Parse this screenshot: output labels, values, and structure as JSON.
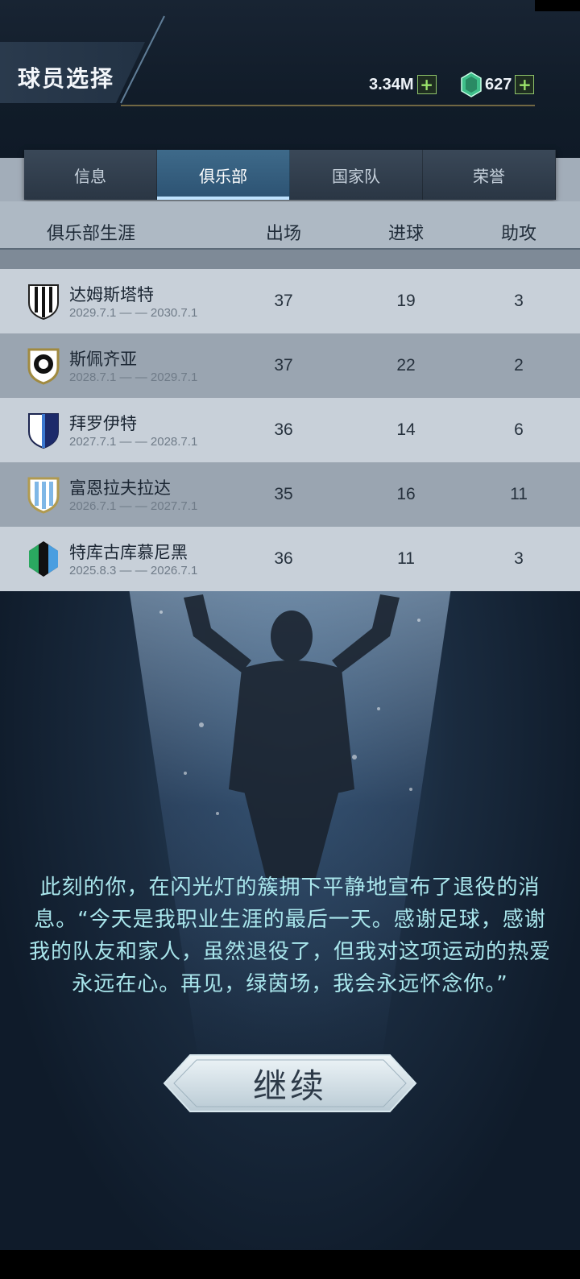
{
  "header": {
    "title": "球员选择",
    "coins": "3.34M",
    "gems": "627"
  },
  "tabs": [
    {
      "label": "信息",
      "active": false
    },
    {
      "label": "俱乐部",
      "active": true
    },
    {
      "label": "国家队",
      "active": false
    },
    {
      "label": "荣誉",
      "active": false
    }
  ],
  "table": {
    "headers": {
      "career": "俱乐部生涯",
      "apps": "出场",
      "goals": "进球",
      "assists": "助攻"
    },
    "rows": [
      {
        "club": "达姆斯塔特",
        "dates": "2029.7.1 — — 2030.7.1",
        "apps": "37",
        "goals": "19",
        "assists": "3",
        "badge": "black-white-stripes"
      },
      {
        "club": "斯佩齐亚",
        "dates": "2028.7.1 — — 2029.7.1",
        "apps": "37",
        "goals": "22",
        "assists": "2",
        "badge": "white-circle-black"
      },
      {
        "club": "拜罗伊特",
        "dates": "2027.7.1 — — 2028.7.1",
        "apps": "36",
        "goals": "14",
        "assists": "6",
        "badge": "white-navy-half"
      },
      {
        "club": "富恩拉夫拉达",
        "dates": "2026.7.1 — — 2027.7.1",
        "apps": "35",
        "goals": "16",
        "assists": "11",
        "badge": "light-blue-stripes"
      },
      {
        "club": "特库古库慕尼黑",
        "dates": "2025.8.3 — — 2026.7.1",
        "apps": "36",
        "goals": "11",
        "assists": "3",
        "badge": "green-black-blue"
      }
    ]
  },
  "message": "此刻的你，在闪光灯的簇拥下平静地宣布了退役的消息。“今天是我职业生涯的最后一天。感谢足球，感谢我的队友和家人，虽然退役了，但我对这项运动的热爱永远在心。再见，绿茵场，我会永远怀念你。”",
  "continue_label": "继续",
  "colors": {
    "accent_text": "#a9e6ec",
    "tab_active": "#2c5272",
    "plus_green": "#9be36b"
  }
}
